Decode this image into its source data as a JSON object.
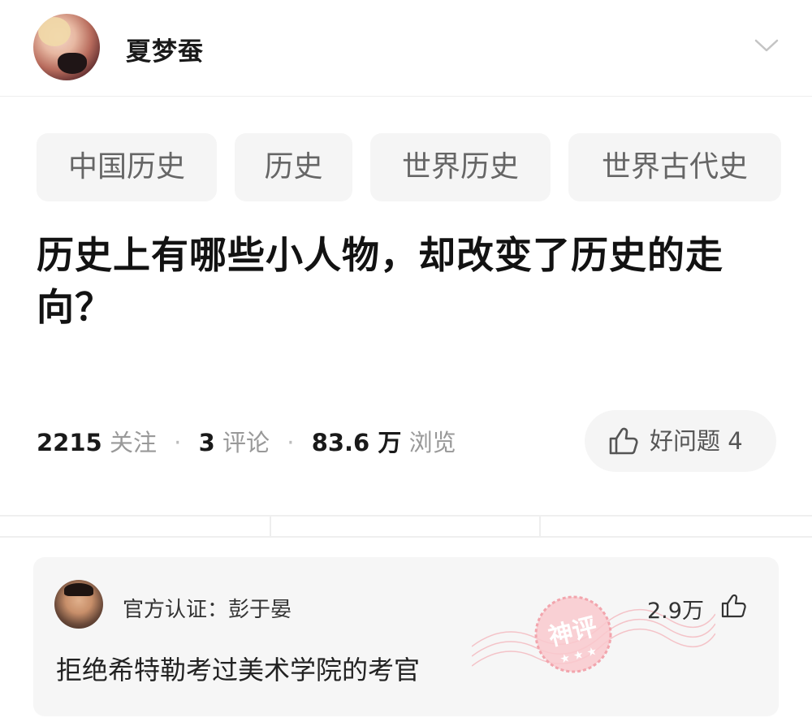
{
  "header": {
    "username": "夏梦蚕",
    "avatar_icon": "user-avatar",
    "menu_icon": "chevron-down-icon"
  },
  "tags": [
    "中国历史",
    "历史",
    "世界历史",
    "世界古代史"
  ],
  "question": {
    "title": "历史上有哪些小人物，却改变了历史的走向？"
  },
  "stats": {
    "followers_num": "2215",
    "followers_label": "关注",
    "comments_num": "3",
    "comments_label": "评论",
    "views_num": "83.6 万",
    "views_label": "浏览",
    "separator": "·"
  },
  "good_question": {
    "label": "好问题 4",
    "icon": "thumbs-up-icon"
  },
  "comment_card": {
    "author": "官方认证：彭于晏",
    "likes": "2.9万",
    "answer": "拒绝希特勒考过美术学院的考官",
    "stamp_text": "神评",
    "colors": {
      "stamp": "#f2a5ad",
      "card_bg": "#f6f6f6"
    }
  }
}
